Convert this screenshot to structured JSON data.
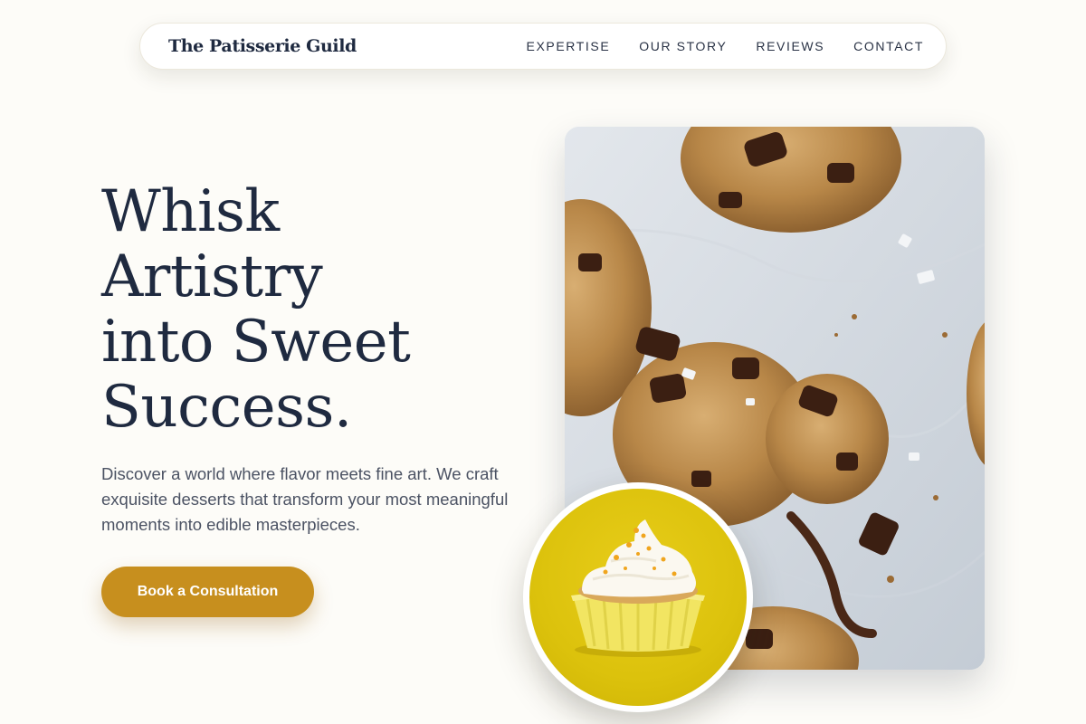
{
  "header": {
    "brand": "The Patisserie Guild",
    "nav": [
      {
        "label": "EXPERTISE"
      },
      {
        "label": "OUR STORY"
      },
      {
        "label": "REVIEWS"
      },
      {
        "label": "CONTACT"
      }
    ]
  },
  "hero": {
    "title_lines": [
      "Whisk",
      "Artistry",
      "into Sweet",
      "Success."
    ],
    "description": "Discover a world where flavor meets fine art. We craft exquisite desserts that transform your most meaningful moments into edible masterpieces.",
    "cta_label": "Book a Consultation"
  },
  "images": {
    "main_photo": "chocolate-chip-cookies-photo",
    "inset_photo": "cupcake-photo"
  },
  "colors": {
    "background": "#fdfcf8",
    "text_dark": "#1f2a40",
    "accent": "#c78f1e",
    "inset_bg": "#e2c614"
  }
}
